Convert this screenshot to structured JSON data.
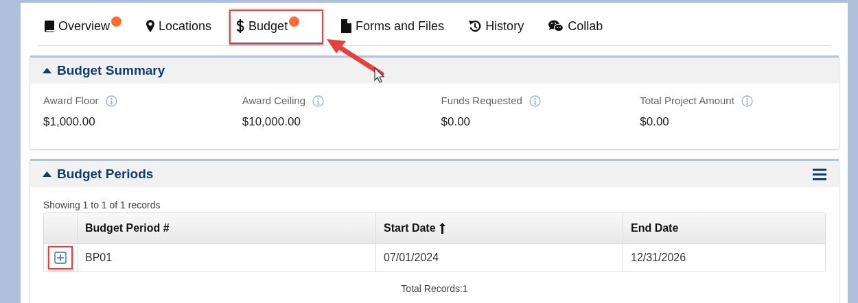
{
  "tabs": [
    {
      "label": "Overview",
      "selected": false,
      "badge": true,
      "highlighted": false
    },
    {
      "label": "Locations",
      "selected": false,
      "badge": false,
      "highlighted": false
    },
    {
      "label": "Budget",
      "selected": true,
      "badge": true,
      "highlighted": true
    },
    {
      "label": "Forms and Files",
      "selected": false,
      "badge": false,
      "highlighted": false
    },
    {
      "label": "History",
      "selected": false,
      "badge": false,
      "highlighted": false
    },
    {
      "label": "Collab",
      "selected": false,
      "badge": false,
      "highlighted": false
    }
  ],
  "budget_summary": {
    "title": "Budget Summary",
    "expanded": true,
    "fields": [
      {
        "label": "Award Floor",
        "value": "$1,000.00"
      },
      {
        "label": "Award Ceiling",
        "value": "$10,000.00"
      },
      {
        "label": "Funds Requested",
        "value": "$0.00"
      },
      {
        "label": "Total Project Amount",
        "value": "$0.00"
      }
    ]
  },
  "budget_periods": {
    "title": "Budget Periods",
    "expanded": true,
    "showing": "Showing 1 to 1 of 1 records",
    "table": {
      "columns": [
        {
          "label": "Budget Period #",
          "sorted": false
        },
        {
          "label": "Start Date",
          "sorted": true
        },
        {
          "label": "End Date",
          "sorted": false
        }
      ],
      "rows": [
        {
          "expanded": false,
          "highlighted": true,
          "cells": [
            "BP01",
            "07/01/2024",
            "12/31/2026"
          ]
        }
      ]
    },
    "total": "Total Records:1"
  }
}
